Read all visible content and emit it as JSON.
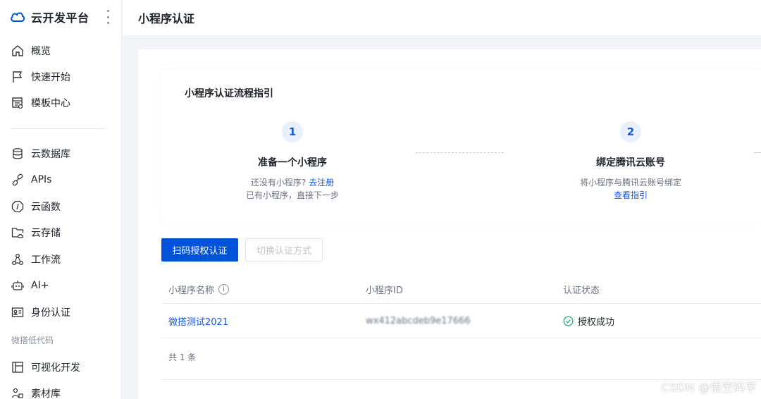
{
  "sidebar": {
    "brand": "云开发平台",
    "items_top": [
      {
        "label": "概览",
        "icon": "home-icon"
      },
      {
        "label": "快速开始",
        "icon": "flag-icon"
      },
      {
        "label": "模板中心",
        "icon": "template-icon"
      }
    ],
    "items_main": [
      {
        "label": "云数据库",
        "icon": "database-icon"
      },
      {
        "label": "APIs",
        "icon": "link-icon"
      },
      {
        "label": "云函数",
        "icon": "function-icon"
      },
      {
        "label": "云存储",
        "icon": "folder-cloud-icon"
      },
      {
        "label": "工作流",
        "icon": "workflow-icon"
      },
      {
        "label": "AI+",
        "icon": "robot-icon"
      },
      {
        "label": "身份认证",
        "icon": "id-card-icon"
      }
    ],
    "section_label": "微搭低代码",
    "items_lowcode": [
      {
        "label": "可视化开发",
        "icon": "layout-icon"
      },
      {
        "label": "素材库",
        "icon": "assets-icon"
      }
    ]
  },
  "header": {
    "title": "小程序认证"
  },
  "guide": {
    "title": "小程序认证流程指引",
    "steps": [
      {
        "num": "1",
        "title": "准备一个小程序",
        "line1_text": "还没有小程序?",
        "line1_link": "去注册",
        "line2": "已有小程序，直接下一步"
      },
      {
        "num": "2",
        "title": "绑定腾讯云账号",
        "line1_text": "将小程序与腾讯云账号绑定",
        "line2_link": "查看指引"
      }
    ]
  },
  "actions": {
    "primary": "扫码授权认证",
    "secondary": "切换认证方式"
  },
  "table": {
    "columns": [
      "小程序名称",
      "小程序ID",
      "认证状态"
    ],
    "rows": [
      {
        "name": "微搭测试2021",
        "id": "wx412abcdeb9e17666",
        "status": "授权成功"
      }
    ],
    "total": "共 1 条"
  },
  "colors": {
    "accent": "#0052d9",
    "success": "#2ba471"
  },
  "watermark": "CSDN @悟空码字"
}
